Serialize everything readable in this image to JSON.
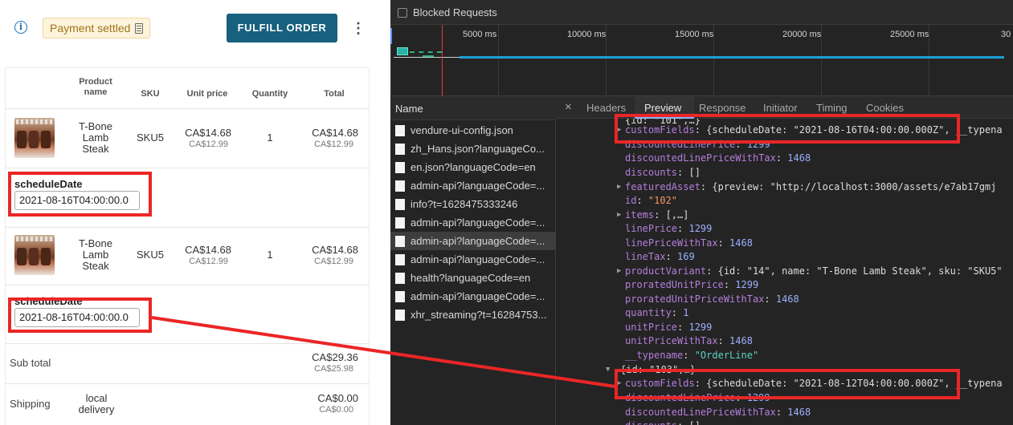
{
  "order": {
    "payment_badge": "Payment settled",
    "fulfill_button": "FULFILL ORDER",
    "more_icon": "⋮"
  },
  "table": {
    "headers": [
      "Product name",
      "SKU",
      "Unit price",
      "Quantity",
      "Total"
    ],
    "rows": [
      {
        "product": "T-Bone Lamb Steak",
        "sku": "SKU5",
        "unit_price": "CA$14.68",
        "unit_price_sub": "CA$12.99",
        "quantity": "1",
        "total": "CA$14.68",
        "total_sub": "CA$12.99",
        "field_label": "scheduleDate",
        "field_value": "2021-08-16T04:00:00.0"
      },
      {
        "product": "T-Bone Lamb Steak",
        "sku": "SKU5",
        "unit_price": "CA$14.68",
        "unit_price_sub": "CA$12.99",
        "quantity": "1",
        "total": "CA$14.68",
        "total_sub": "CA$12.99",
        "field_label": "scheduleDate",
        "field_value": "2021-08-16T04:00:00.0"
      }
    ],
    "subtotal": {
      "label": "Sub total",
      "value": "CA$29.36",
      "sub": "CA$25.98"
    },
    "shipping": {
      "label": "Shipping",
      "method": "local delivery",
      "value": "CA$0.00",
      "sub": "CA$0.00"
    }
  },
  "devtools": {
    "blocked_requests": "Blocked Requests",
    "timeline_ticks": [
      "5000 ms",
      "10000 ms",
      "15000 ms",
      "20000 ms",
      "25000 ms",
      "30"
    ],
    "name_header": "Name",
    "requests": [
      "vendure-ui-config.json",
      "zh_Hans.json?languageCo...",
      "en.json?languageCode=en",
      "admin-api?languageCode=...",
      "info?t=1628475333246",
      "admin-api?languageCode=...",
      "admin-api?languageCode=...",
      "admin-api?languageCode=...",
      "health?languageCode=en",
      "admin-api?languageCode=...",
      "xhr_streaming?t=16284753..."
    ],
    "tabs": [
      "Headers",
      "Preview",
      "Response",
      "Initiator",
      "Timing",
      "Cookies"
    ],
    "active_tab": "Preview",
    "close_icon": "×",
    "preview": {
      "line0": "{id: \"101\",…}",
      "customFields_1": "{scheduleDate: \"2021-08-16T04:00:00.000Z\", __typena",
      "discountedLinePrice": "1299",
      "discountedLinePriceWithTax": "1468",
      "discounts": "[]",
      "featuredAsset": "{preview: \"http://localhost:3000/assets/e7ab17gmj",
      "id": "\"102\"",
      "items": "[,…]",
      "linePrice": "1299",
      "linePriceWithTax": "1468",
      "lineTax": "169",
      "productVariant": "{id: \"14\", name: \"T-Bone Lamb Steak\", sku: \"SKU5\"",
      "proratedUnitPrice": "1299",
      "proratedUnitPriceWithTax": "1468",
      "quantity": "1",
      "unitPrice": "1299",
      "unitPriceWithTax": "1468",
      "typename": "\"OrderLine\"",
      "line_next": "{id: \"103\",…}",
      "customFields_2": "{scheduleDate: \"2021-08-12T04:00:00.000Z\", __typena",
      "discountedLinePrice_2": "1299",
      "discountedLinePriceWithTax_2": "1468",
      "discounts_2": "[]"
    }
  },
  "colors": {
    "accent": "#17607e",
    "highlight": "#ea2626",
    "badge_bg": "#fdf4dc",
    "devtools_bg": "#242424"
  }
}
